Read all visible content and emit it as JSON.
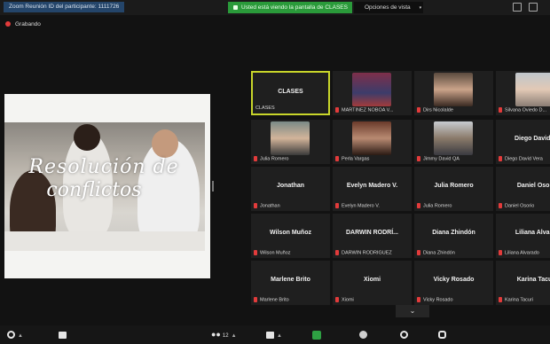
{
  "topbar": {
    "meeting_id": "Zoom Reunión ID del participante: 1111726",
    "share_banner": "Usted está viendo la pantalla de CLASES",
    "view_options": "Opciones de vista",
    "view_caret": "▾"
  },
  "recording": {
    "label": "Grabando"
  },
  "slide": {
    "title_line1": "Resolución de",
    "title_line2": "conflictos"
  },
  "participants": [
    {
      "name": "CLASES",
      "label": "CLASES",
      "active": true,
      "video": false
    },
    {
      "name": "",
      "label": "MARTINEZ NOBOA V...",
      "video": true,
      "style": "v1"
    },
    {
      "name": "",
      "label": "Dirs Nicolalde",
      "video": true,
      "style": "v2"
    },
    {
      "name": "",
      "label": "Silvana Oviedo D...",
      "video": true,
      "style": "v3"
    },
    {
      "name": "",
      "label": "Julia Romero",
      "video": true,
      "style": "v4"
    },
    {
      "name": "",
      "label": "Perla Vargas",
      "video": true,
      "style": "v5"
    },
    {
      "name": "",
      "label": "Jimmy David QA",
      "video": true,
      "style": "v6"
    },
    {
      "name": "Diego David V",
      "label": "Diego David Vera",
      "video": false
    },
    {
      "name": "Jonathan",
      "label": "Jonathan",
      "video": false
    },
    {
      "name": "Evelyn Madero V.",
      "label": "Evelyn Madero V.",
      "video": false
    },
    {
      "name": "Julia Romero",
      "label": "Julia Romero",
      "video": false
    },
    {
      "name": "Daniel Osori",
      "label": "Daniel Osorio",
      "video": false
    },
    {
      "name": "Wilson Muñoz",
      "label": "Wilson Muñoz",
      "video": false
    },
    {
      "name": "DARWIN RODRÍ...",
      "label": "DARWIN RODRIGUEZ",
      "video": false
    },
    {
      "name": "Diana Zhindón",
      "label": "Diana Zhindón",
      "video": false
    },
    {
      "name": "Liliana Alvara",
      "label": "Liliana Alvarado",
      "video": false
    },
    {
      "name": "Marlene Brito",
      "label": "Marlene Brito",
      "video": false
    },
    {
      "name": "Xiomi",
      "label": "Xiomi",
      "video": false
    },
    {
      "name": "Vicky Rosado",
      "label": "Vicky Rosado",
      "video": false
    },
    {
      "name": "Karina Tacui",
      "label": "Karina Tacuri",
      "video": false
    }
  ],
  "more_participants": "⌄",
  "toolbar": {
    "participants_count": "12"
  },
  "colors": {
    "active_border": "#c8d52a",
    "share_green": "#2a9a3a",
    "recording_red": "#e23b3b",
    "mute_red": "#e23b3b"
  }
}
